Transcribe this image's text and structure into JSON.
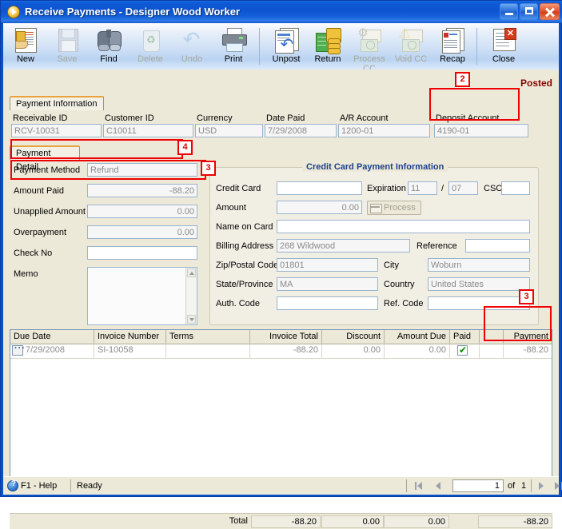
{
  "window": {
    "title": "Receive Payments - Designer Wood Worker",
    "icon": "play-circle-icon",
    "buttons": {
      "minimize": "minimize-icon",
      "maximize": "maximize-icon",
      "close": "close-icon"
    }
  },
  "toolbar": {
    "items": [
      {
        "label": "New",
        "icon": "new-document-icon",
        "disabled": false
      },
      {
        "label": "Save",
        "icon": "save-floppy-icon",
        "disabled": true
      },
      {
        "label": "Find",
        "icon": "binoculars-icon",
        "disabled": false
      },
      {
        "label": "Delete",
        "icon": "recycle-bin-icon",
        "disabled": true
      },
      {
        "label": "Undo",
        "icon": "undo-arrow-icon",
        "disabled": true
      },
      {
        "label": "Print",
        "icon": "printer-icon",
        "disabled": false
      },
      {
        "label": "Unpost",
        "icon": "unpost-icon",
        "disabled": false
      },
      {
        "label": "Return",
        "icon": "return-money-icon",
        "disabled": false
      },
      {
        "label": "Process CC",
        "icon": "process-cc-gear-icon",
        "disabled": true
      },
      {
        "label": "Void CC",
        "icon": "void-cc-warning-icon",
        "disabled": true
      },
      {
        "label": "Recap",
        "icon": "recap-report-icon",
        "disabled": false
      },
      {
        "label": "Close",
        "icon": "close-document-icon",
        "disabled": false
      }
    ]
  },
  "payment_information": {
    "tab_label": "Payment Information",
    "status": "Posted",
    "fields": [
      {
        "label": "Receivable ID",
        "value": "RCV-10031"
      },
      {
        "label": "Customer ID",
        "value": "C10011"
      },
      {
        "label": "Currency",
        "value": "USD"
      },
      {
        "label": "Date Paid",
        "value": "7/29/2008"
      },
      {
        "label": "A/R Account",
        "value": "1200-01"
      },
      {
        "label": "Deposit Account",
        "value": "4190-01"
      }
    ]
  },
  "payment_detail": {
    "tab_label": "Payment Detail",
    "fields": [
      {
        "label": "Payment Method",
        "value": "Refund"
      },
      {
        "label": "Amount Paid",
        "value": "-88.20"
      },
      {
        "label": "Unapplied Amount",
        "value": "0.00"
      },
      {
        "label": "Overpayment",
        "value": "0.00"
      },
      {
        "label": "Check No",
        "value": ""
      },
      {
        "label": "Memo",
        "value": ""
      }
    ]
  },
  "credit_card": {
    "group_title": "Credit Card Payment Information",
    "labels": {
      "credit_card": "Credit Card",
      "expiration": "Expiration",
      "slash": "/",
      "csc": "CSC",
      "amount": "Amount",
      "process": "Process",
      "name_on_card": "Name on Card",
      "billing_address": "Billing Address",
      "reference": "Reference",
      "zip": "Zip/Postal Code",
      "city": "City",
      "state": "State/Province",
      "country": "Country",
      "auth_code": "Auth. Code",
      "ref_code": "Ref. Code"
    },
    "values": {
      "credit_card": "",
      "expiration_month": "11",
      "expiration_year": "07",
      "csc": "",
      "amount": "0.00",
      "name_on_card": "",
      "billing_address": "268 Wildwood",
      "reference": "",
      "zip": "01801",
      "city": "Woburn",
      "state": "MA",
      "country": "United States",
      "auth_code": "",
      "ref_code": ""
    }
  },
  "grid": {
    "headers": [
      "Due Date",
      "Invoice Number",
      "Terms",
      "Invoice Total",
      "Discount",
      "Amount Due",
      "Paid",
      "",
      "Payment"
    ],
    "rows": [
      {
        "due_date": "7/29/2008",
        "invoice_number": "SI-10058",
        "terms": "",
        "invoice_total": "-88.20",
        "discount": "0.00",
        "amount_due": "0.00",
        "paid": true,
        "spacer": "",
        "payment": "-88.20"
      }
    ],
    "totals": {
      "label": "Total",
      "invoice_total": "-88.20",
      "discount": "0.00",
      "amount_due": "0.00",
      "payment": "-88.20"
    }
  },
  "status_bar": {
    "help": "F1 - Help",
    "status": "Ready",
    "nav": {
      "page": "1",
      "of_label": "of",
      "total": "1"
    }
  },
  "annotations": [
    {
      "id": "2",
      "target": "deposit-account-field"
    },
    {
      "id": "4",
      "target": "payment-method-field"
    },
    {
      "id": "3",
      "target": "amount-paid-field"
    },
    {
      "id": "3",
      "target": "payment-column"
    }
  ],
  "colors": {
    "title_bar": "#0d53cf",
    "annotation_red": "#ee0000",
    "posted_text": "#8b0000",
    "group_title_blue": "#1b3f8f",
    "tab_accent": "#e8a33d"
  }
}
